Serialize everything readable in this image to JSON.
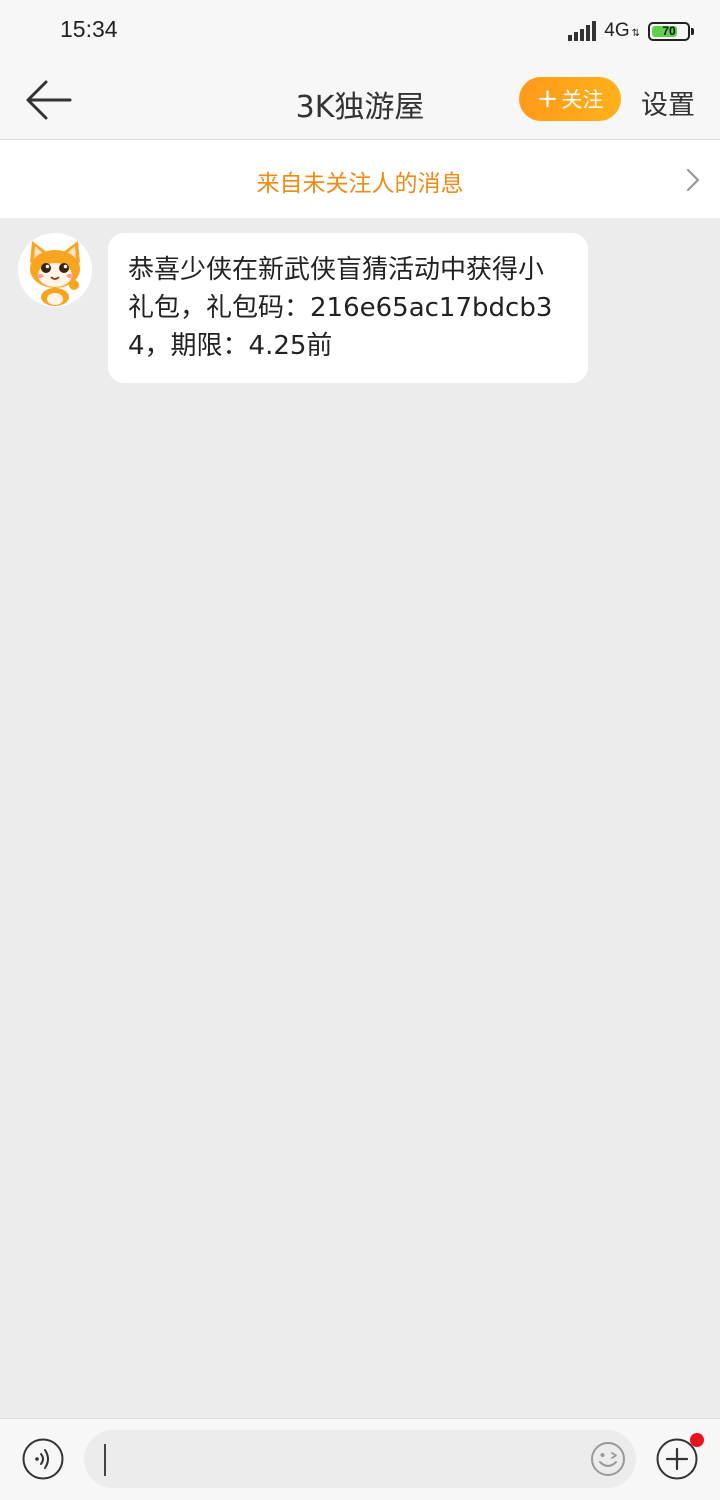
{
  "status_bar": {
    "time": "15:34",
    "network": "4G",
    "battery_level": "70",
    "battery_color": "#5fd14a"
  },
  "header": {
    "back_icon": "arrow-left-icon",
    "title": "3K独游屋",
    "follow_label": "关注",
    "follow_plus": "+",
    "settings_label": "设置",
    "accent": "#ff9a1a"
  },
  "notice": {
    "text": "来自未关注人的消息",
    "color": "#f08a14",
    "chevron_icon": "chevron-right-icon"
  },
  "messages": [
    {
      "sender_avatar": "cat-mascot-avatar",
      "text": "恭喜少侠在新武侠盲猜活动中获得小礼包，礼包码：216e65ac17bdcb34，期限：4.25前"
    }
  ],
  "input_bar": {
    "voice_icon": "voice-icon",
    "input_value": "",
    "emoji_icon": "emoji-icon",
    "plus_icon": "plus-circle-icon",
    "has_notification_dot": true
  }
}
